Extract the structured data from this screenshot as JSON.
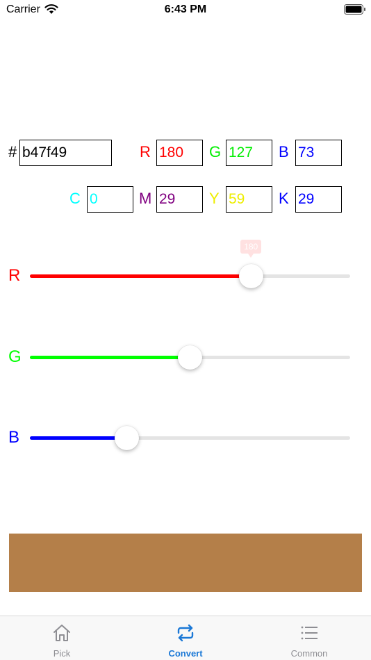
{
  "status_bar": {
    "carrier": "Carrier",
    "time": "6:43 PM"
  },
  "hex": {
    "prefix": "#",
    "value": "b47f49"
  },
  "rgb": {
    "r": {
      "label": "R",
      "value": "180",
      "color": "#ff0000"
    },
    "g": {
      "label": "G",
      "value": "127",
      "color": "#00ee00"
    },
    "b": {
      "label": "B",
      "value": "73",
      "color": "#0000ff"
    }
  },
  "cmyk": {
    "c": {
      "label": "C",
      "value": "0",
      "color": "#00ffff"
    },
    "m": {
      "label": "M",
      "value": "29",
      "color": "#800080"
    },
    "y": {
      "label": "Y",
      "value": "59",
      "color": "#eeee00"
    },
    "k": {
      "label": "K",
      "value": "29",
      "color": "#0000ff"
    }
  },
  "sliders": {
    "r": {
      "label": "R",
      "value": 180,
      "max": 255,
      "color": "#ff0000",
      "bubble": "180"
    },
    "g": {
      "label": "G",
      "value": 127,
      "max": 255,
      "color": "#00ff00"
    },
    "b": {
      "label": "B",
      "value": 73,
      "max": 255,
      "color": "#0000ff"
    }
  },
  "preview_color": "#b47f49",
  "tabs": [
    {
      "label": "Pick",
      "icon": "home-icon",
      "active": false
    },
    {
      "label": "Convert",
      "icon": "convert-icon",
      "active": true
    },
    {
      "label": "Common",
      "icon": "list-icon",
      "active": false
    }
  ],
  "colors": {
    "tab_active": "#1a78d6",
    "tab_inactive": "#8e8e93",
    "track": "#e4e4e4"
  }
}
